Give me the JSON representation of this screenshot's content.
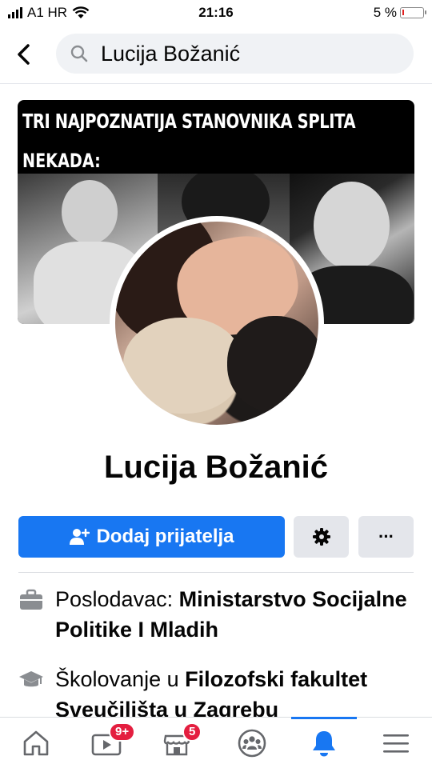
{
  "status_bar": {
    "carrier": "A1 HR",
    "time": "21:16",
    "battery": "5 %",
    "battery_level": 0.05
  },
  "header": {
    "back_icon": "chevron-left-icon",
    "search_icon": "search-icon",
    "search_value": "Lucija Božanić"
  },
  "cover": {
    "title": "TRI NAJPOZNATIJA STANOVNIKA SPLITA",
    "subtitle": "NEKADA:"
  },
  "profile": {
    "name": "Lucija Božanić"
  },
  "actions": {
    "add_friend_label": "Dodaj prijatelja",
    "add_friend_icon": "add-friend-icon",
    "settings_icon": "gear-icon",
    "more_label": "···"
  },
  "details": {
    "employer_prefix": "Poslodavac: ",
    "employer": "Ministarstvo Socijalne Politike I Mladih",
    "education_prefix": "Školovanje u ",
    "education": "Filozofski fakultet Sveučilišta u Zagrebu"
  },
  "bottom_nav": {
    "items": [
      {
        "name": "home",
        "icon": "home-icon"
      },
      {
        "name": "watch",
        "icon": "video-icon",
        "badge": "9+"
      },
      {
        "name": "marketplace",
        "icon": "marketplace-icon",
        "badge": "5"
      },
      {
        "name": "groups",
        "icon": "groups-icon"
      },
      {
        "name": "notifications",
        "icon": "bell-icon",
        "active": true
      },
      {
        "name": "menu",
        "icon": "menu-icon"
      }
    ]
  },
  "colors": {
    "accent": "#1877f2",
    "badge": "#e41e3f",
    "button_gray": "#e4e6eb"
  }
}
